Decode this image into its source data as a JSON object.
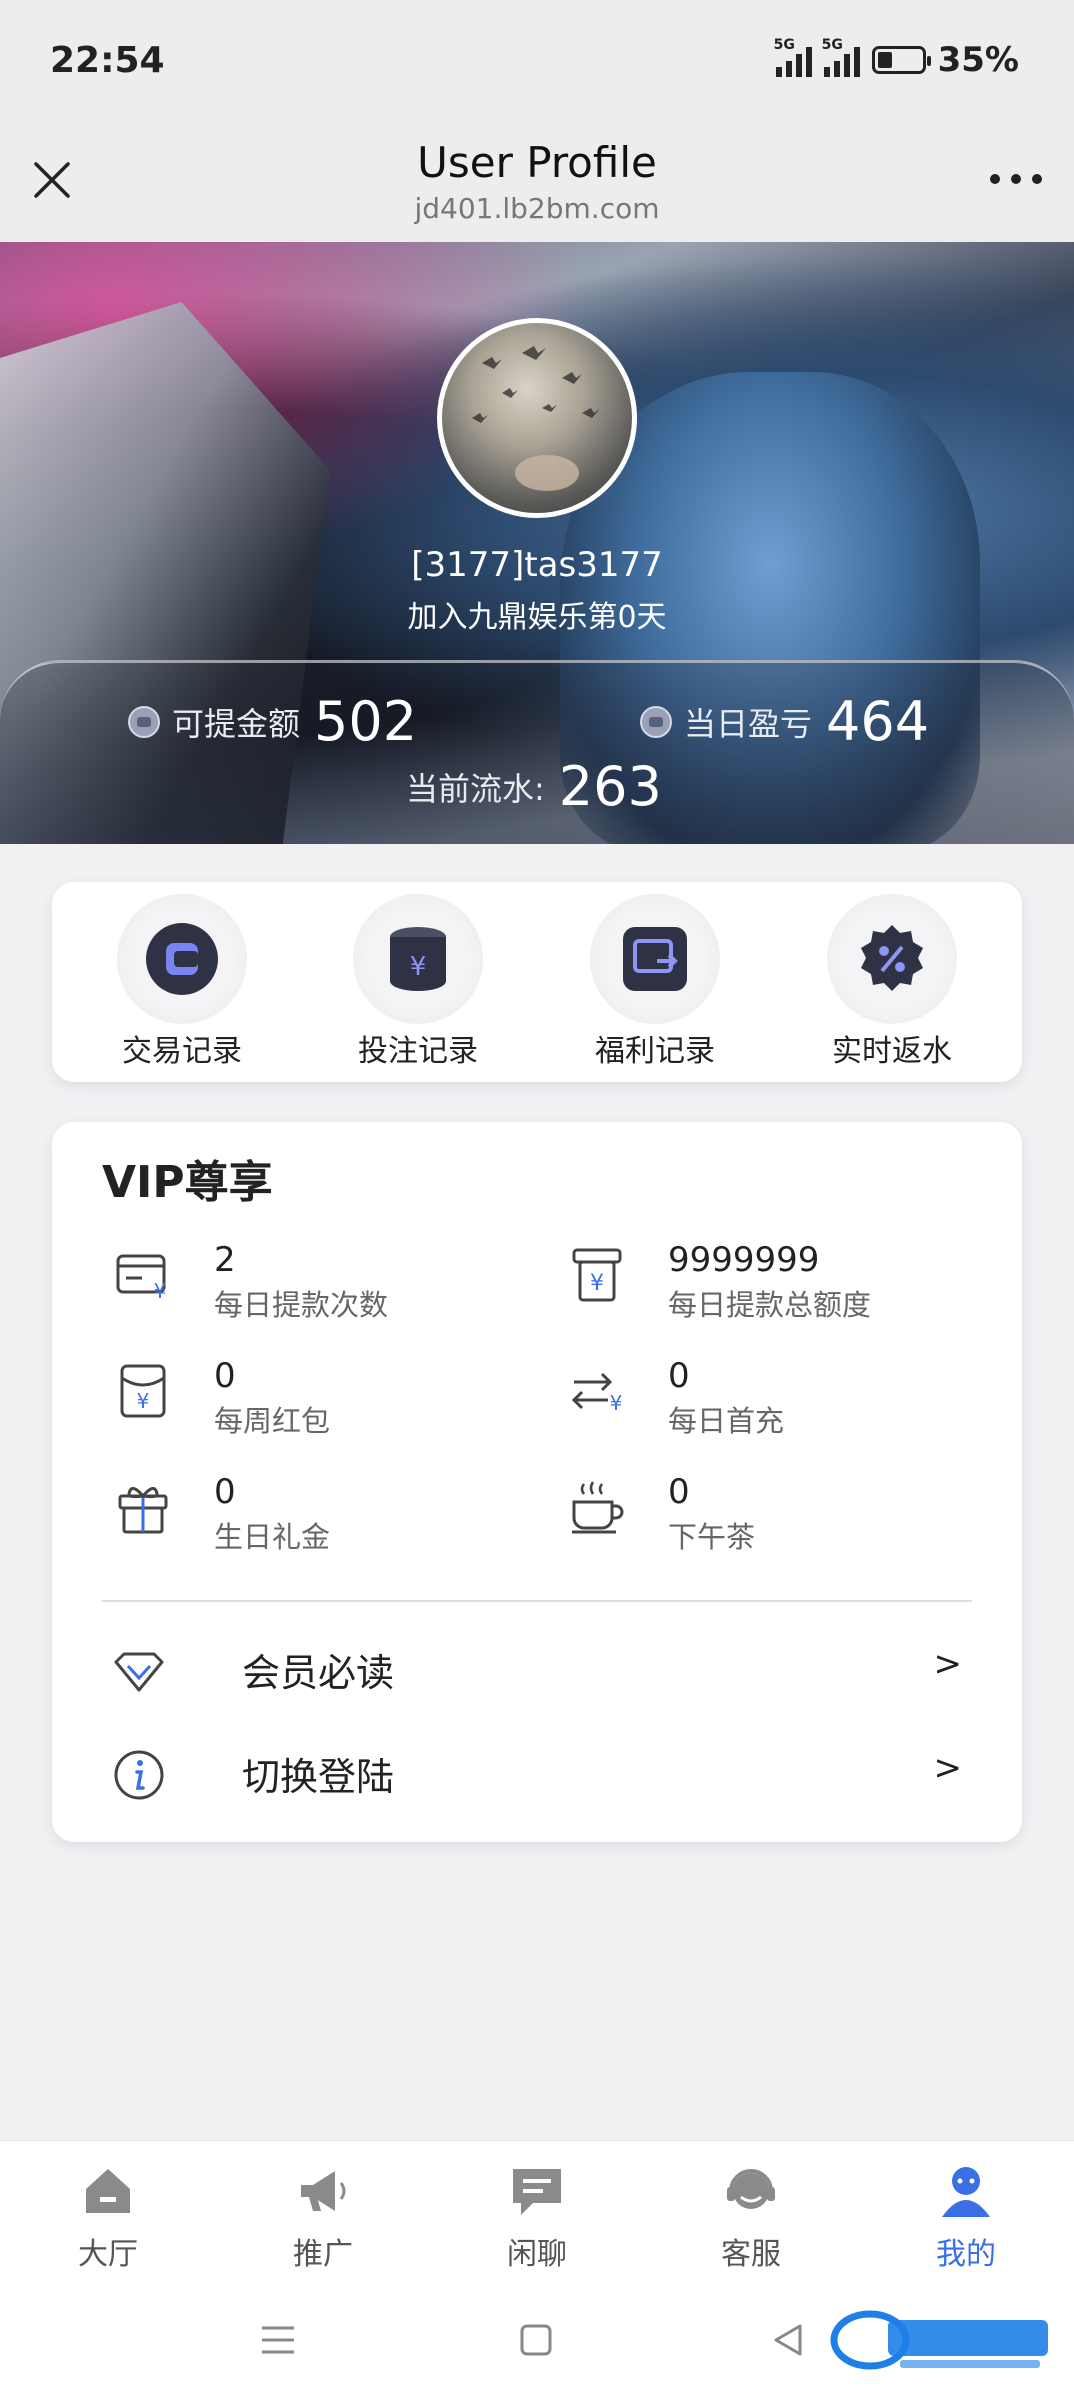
{
  "status_bar": {
    "time": "22:54",
    "network1": "5G",
    "network2": "5G",
    "battery": "35%"
  },
  "header": {
    "title": "User Profile",
    "subtitle": "jd401.lb2bm.com"
  },
  "profile": {
    "username": "[3177]tas3177",
    "join_text": "加入九鼎娱乐第0天",
    "withdrawable_label": "可提金额",
    "withdrawable_value": "502",
    "daily_pl_label": "当日盈亏",
    "daily_pl_value": "464",
    "turnover_label": "当前流水:",
    "turnover_value": "263"
  },
  "quick_actions": [
    {
      "label": "交易记录",
      "icon": "transaction-icon"
    },
    {
      "label": "投注记录",
      "icon": "bet-record-icon"
    },
    {
      "label": "福利记录",
      "icon": "welfare-icon"
    },
    {
      "label": "实时返水",
      "icon": "rebate-icon"
    }
  ],
  "vip": {
    "title": "VIP尊享",
    "perks": [
      {
        "value": "2",
        "label": "每日提款次数",
        "icon": "withdraw-card-icon"
      },
      {
        "value": "9999999",
        "label": "每日提款总额度",
        "icon": "withdraw-limit-icon"
      },
      {
        "value": "0",
        "label": "每周红包",
        "icon": "red-envelope-icon"
      },
      {
        "value": "0",
        "label": "每日首充",
        "icon": "first-deposit-icon"
      },
      {
        "value": "0",
        "label": "生日礼金",
        "icon": "gift-icon"
      },
      {
        "value": "0",
        "label": "下午茶",
        "icon": "tea-cup-icon"
      }
    ],
    "links": [
      {
        "label": "会员必读",
        "arrow": ">",
        "icon": "diamond-icon"
      },
      {
        "label": "切换登陆",
        "arrow": ">",
        "icon": "info-icon"
      }
    ]
  },
  "bottom_nav": [
    {
      "label": "大厅",
      "icon": "home-icon",
      "active": false
    },
    {
      "label": "推广",
      "icon": "megaphone-icon",
      "active": false
    },
    {
      "label": "闲聊",
      "icon": "chat-icon",
      "active": false
    },
    {
      "label": "客服",
      "icon": "support-icon",
      "active": false
    },
    {
      "label": "我的",
      "icon": "profile-icon",
      "active": true
    }
  ],
  "colors": {
    "accent": "#3b6fe6",
    "card_bg": "#ffffff",
    "page_bg": "#f1f1f4"
  }
}
